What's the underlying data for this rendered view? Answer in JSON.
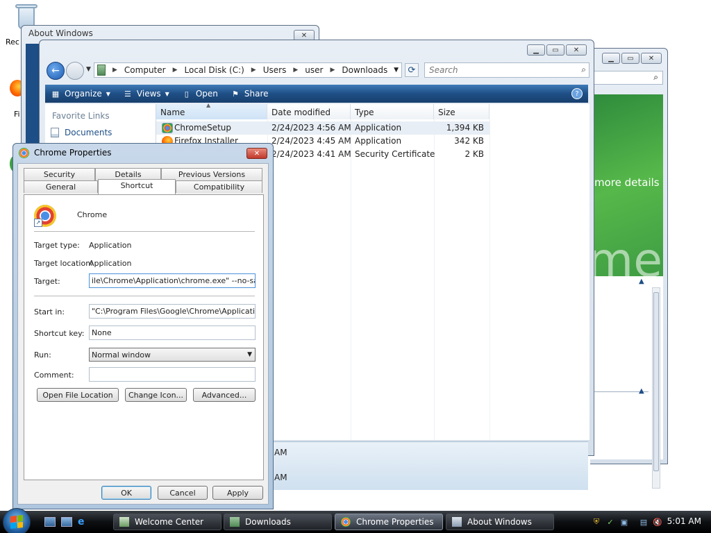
{
  "desktop": {
    "recycle_label": "Rec",
    "firefox_label": "Fi"
  },
  "about_window": {
    "title": "About Windows",
    "close_glyph": "✕"
  },
  "welcome_window": {
    "more_details": "more details",
    "banner_text": "me"
  },
  "explorer": {
    "breadcrumbs": [
      "Computer",
      "Local Disk (C:)",
      "Users",
      "user",
      "Downloads"
    ],
    "search_placeholder": "Search",
    "toolbar": {
      "organize": "Organize",
      "views": "Views",
      "open": "Open",
      "share": "Share"
    },
    "nav": {
      "favorite_links": "Favorite Links",
      "documents": "Documents"
    },
    "columns": [
      "Name",
      "Date modified",
      "Type",
      "Size"
    ],
    "files": [
      {
        "name": "ChromeSetup",
        "date": "2/24/2023 4:56 AM",
        "type": "Application",
        "size": "1,394 KB"
      },
      {
        "name": "Firefox Installer",
        "date": "2/24/2023 4:45 AM",
        "type": "Application",
        "size": "342 KB"
      },
      {
        "name": "",
        "date": "2/24/2023 4:41 AM",
        "type": "Security Certificate",
        "size": "2 KB"
      }
    ],
    "details": {
      "line1": "AM",
      "line2": "AM"
    }
  },
  "properties": {
    "title": "Chrome Properties",
    "tabs_top": [
      "Security",
      "Details",
      "Previous Versions"
    ],
    "tabs_bottom": [
      "General",
      "Shortcut",
      "Compatibility"
    ],
    "app_name": "Chrome",
    "target_type_label": "Target type:",
    "target_type_value": "Application",
    "target_location_label": "Target location:",
    "target_location_value": "Application",
    "target_label": "Target:",
    "target_value": "ile\\Chrome\\Application\\chrome.exe\" --no-sandbox",
    "start_in_label": "Start in:",
    "start_in_value": "\"C:\\Program Files\\Google\\Chrome\\Application\"",
    "shortcut_key_label": "Shortcut key:",
    "shortcut_key_value": "None",
    "run_label": "Run:",
    "run_value": "Normal window",
    "comment_label": "Comment:",
    "comment_value": "",
    "buttons": {
      "open_file_location": "Open File Location",
      "change_icon": "Change Icon...",
      "advanced": "Advanced...",
      "ok": "OK",
      "cancel": "Cancel",
      "apply": "Apply"
    }
  },
  "taskbar": {
    "tasks": [
      "Welcome Center",
      "Downloads",
      "Chrome Properties",
      "About Windows"
    ],
    "clock": "5:01 AM"
  }
}
